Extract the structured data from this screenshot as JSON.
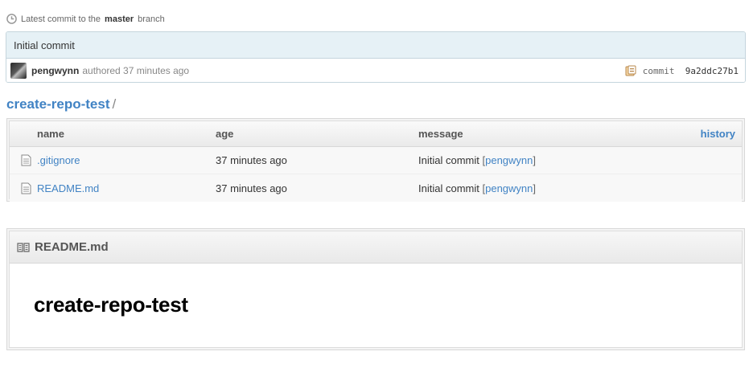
{
  "latest_commit": {
    "prefix": "Latest commit to the",
    "branch": "master",
    "suffix": "branch",
    "message": "Initial commit",
    "author": "pengwynn",
    "authored_text": "authored 37 minutes ago",
    "commit_label": "commit",
    "sha": "9a2ddc27b1"
  },
  "breadcrumb": {
    "repo": "create-repo-test",
    "separator": "/"
  },
  "file_table": {
    "headers": {
      "name": "name",
      "age": "age",
      "message": "message",
      "history": "history"
    },
    "rows": [
      {
        "name": ".gitignore",
        "age": "37 minutes ago",
        "message": "Initial commit",
        "author": "pengwynn",
        "icon": "file-icon"
      },
      {
        "name": "README.md",
        "age": "37 minutes ago",
        "message": "Initial commit",
        "author": "pengwynn",
        "icon": "file-icon"
      }
    ]
  },
  "readme": {
    "filename": "README.md",
    "heading": "create-repo-test"
  },
  "colors": {
    "link": "#4183c4",
    "commit_bg": "#e6f1f6",
    "commit_border": "#c5d5dd"
  }
}
